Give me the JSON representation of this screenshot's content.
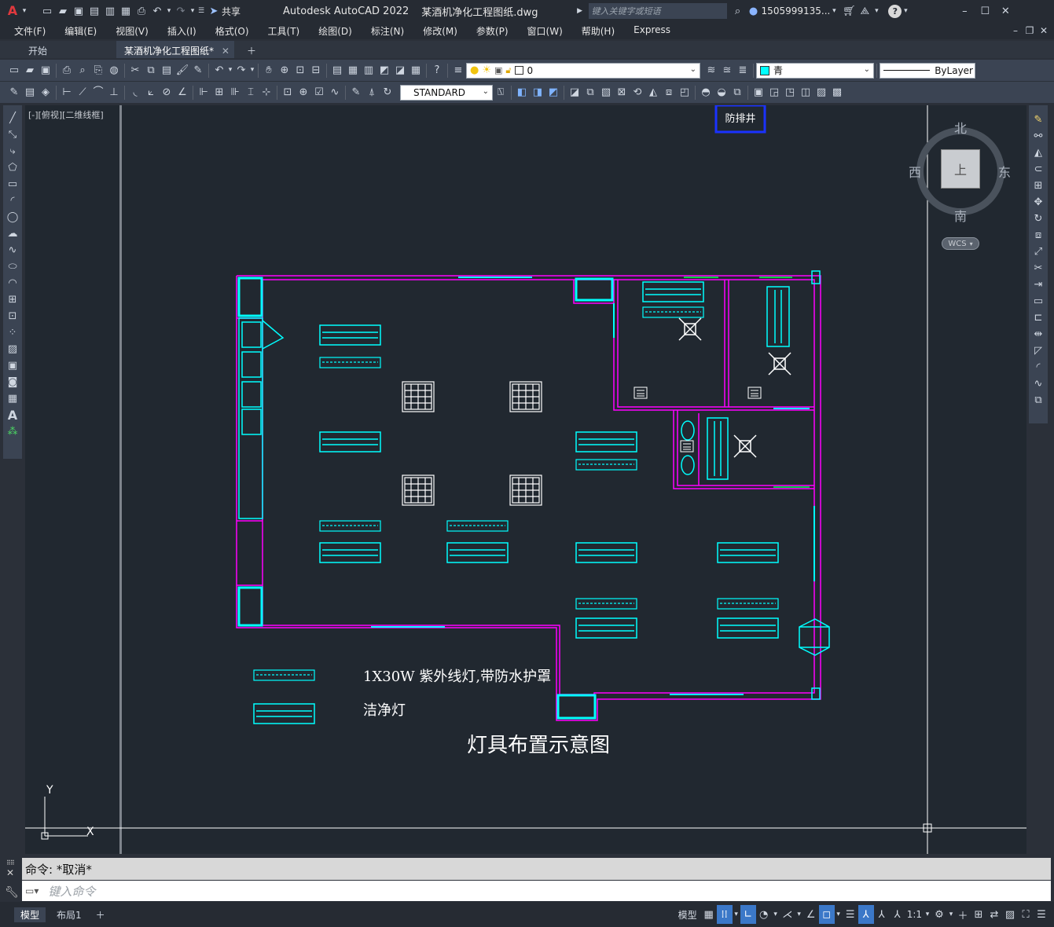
{
  "window": {
    "app_title": "Autodesk AutoCAD 2022",
    "file_name": "某酒机净化工程图纸.dwg",
    "search_placeholder": "键入关键字或短语",
    "user": "1505999135...",
    "share_label": "共享"
  },
  "menu": [
    "文件(F)",
    "编辑(E)",
    "视图(V)",
    "插入(I)",
    "格式(O)",
    "工具(T)",
    "绘图(D)",
    "标注(N)",
    "修改(M)",
    "参数(P)",
    "窗口(W)",
    "帮助(H)",
    "Express"
  ],
  "tabs": {
    "start": "开始",
    "doc": "某酒机净化工程图纸*"
  },
  "toolbar": {
    "layer_value": "0",
    "color_value": "青",
    "linetype_value": "ByLayer",
    "textstyle_value": "STANDARD",
    "accent": "#00ffff"
  },
  "viewport": {
    "label": "[-][俯视][二维线框]",
    "viewcube": {
      "north": "北",
      "south": "南",
      "east": "东",
      "west": "西",
      "top": "上",
      "wcs": "WCS"
    },
    "ucs": {
      "y": "Y",
      "x": "X"
    }
  },
  "drawing": {
    "legend_uv": "1X30W 紫外线灯,带防水护罩",
    "legend_clean": "洁净灯",
    "title": "灯具布置示意图",
    "top_label": "防排井",
    "wall_color": "#ff00ff",
    "fixture_color": "#00ffff"
  },
  "command": {
    "history": "命令: *取消*",
    "placeholder": "键入命令"
  },
  "status": {
    "layout_tabs": [
      "模型",
      "布局1"
    ],
    "model_label": "模型",
    "scale": "1:1"
  }
}
